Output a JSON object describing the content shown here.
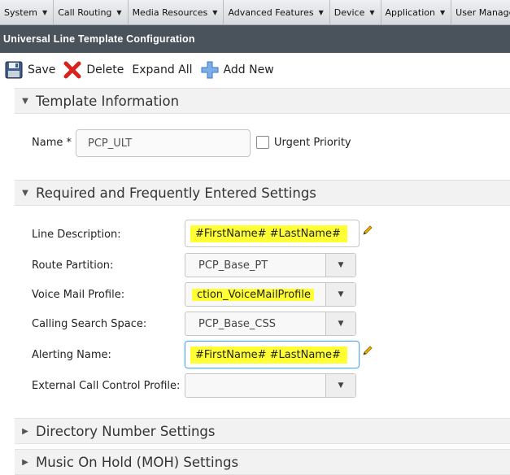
{
  "menu": {
    "items": [
      {
        "label": "System"
      },
      {
        "label": "Call Routing"
      },
      {
        "label": "Media Resources"
      },
      {
        "label": "Advanced Features"
      },
      {
        "label": "Device"
      },
      {
        "label": "Application"
      },
      {
        "label": "User Management"
      }
    ]
  },
  "page": {
    "title": "Universal Line Template Configuration"
  },
  "toolbar": {
    "save_label": "Save",
    "delete_label": "Delete",
    "expand_all_label": "Expand All",
    "add_new_label": "Add New"
  },
  "sections": {
    "template_info": "Template Information",
    "required_settings": "Required and Frequently Entered Settings",
    "directory_number": "Directory Number Settings",
    "moh": "Music On Hold (MOH) Settings"
  },
  "template_info": {
    "name_label": "Name *",
    "name_value": "PCP_ULT",
    "urgent_priority_label": "Urgent Priority"
  },
  "settings": {
    "line_description_label": "Line Description:",
    "line_description_value": "#FirstName# #LastName#",
    "route_partition_label": "Route Partition:",
    "route_partition_value": "PCP_Base_PT",
    "voice_mail_profile_label": "Voice Mail Profile:",
    "voice_mail_profile_value": "ction_VoiceMailProfile",
    "calling_search_space_label": "Calling Search Space:",
    "calling_search_space_value": "PCP_Base_CSS",
    "alerting_name_label": "Alerting Name:",
    "alerting_name_value": "#FirstName# #LastName#",
    "external_call_control_label": "External Call Control Profile:",
    "external_call_control_value": ""
  },
  "icons": {
    "save": "floppy-disk-icon",
    "delete": "red-x-icon",
    "add_new": "blue-plus-icon",
    "edit": "pencil-icon",
    "dropdown": "chevron-down-icon"
  },
  "colors": {
    "title_bar": "#4a525c",
    "highlight": "#ffff33",
    "delete_red": "#d9221c",
    "add_blue": "#3a78c4"
  }
}
